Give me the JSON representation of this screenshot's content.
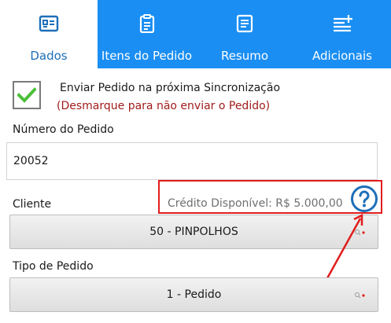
{
  "tabs": [
    {
      "label": "Dados",
      "icon": "contact-card-icon"
    },
    {
      "label": "Itens do Pedido",
      "icon": "clipboard-list-icon"
    },
    {
      "label": "Resumo",
      "icon": "document-lines-icon"
    },
    {
      "label": "Adicionais",
      "icon": "list-add-icon"
    }
  ],
  "sync": {
    "checked": true,
    "title": "Enviar Pedido na próxima Sincronização",
    "hint": "(Desmarque para não enviar o Pedido)"
  },
  "numero": {
    "label": "Número do Pedido",
    "value": "20052"
  },
  "cliente": {
    "label": "Cliente",
    "credit": "Crédito Disponível: R$ 5.000,00",
    "value": "50 - PINPOLHOS"
  },
  "tipo": {
    "label": "Tipo de Pedido",
    "value": "1 - Pedido"
  },
  "colors": {
    "tab_active_text": "#1e6fb8",
    "tab_bar": "#1a8ef2",
    "check": "#4cbf3a",
    "hint": "#a01c1c",
    "annotation": "#e11d1d",
    "help": "#1e6fb8"
  }
}
